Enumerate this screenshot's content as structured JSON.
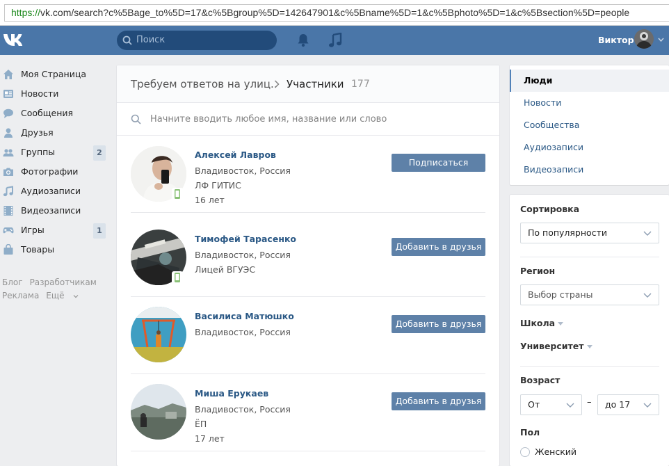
{
  "browser": {
    "url_scheme": "https://",
    "url_rest": "vk.com/search?c%5Bage_to%5D=17&c%5Bgroup%5D=142647901&c%5Bname%5D=1&c%5Bphoto%5D=1&c%5Bsection%5D=people"
  },
  "header": {
    "search_placeholder": "Поиск",
    "user_name": "Виктор",
    "icons": [
      "vk-logo",
      "search-icon",
      "bell-icon",
      "music-icon",
      "avatar",
      "chevron-down-icon"
    ]
  },
  "sidebar": {
    "items": [
      {
        "label": "Моя Страница",
        "icon": "home-icon",
        "count": ""
      },
      {
        "label": "Новости",
        "icon": "news-icon",
        "count": ""
      },
      {
        "label": "Сообщения",
        "icon": "message-icon",
        "count": ""
      },
      {
        "label": "Друзья",
        "icon": "user-icon",
        "count": ""
      },
      {
        "label": "Группы",
        "icon": "users-icon",
        "count": "2"
      },
      {
        "label": "Фотографии",
        "icon": "camera-icon",
        "count": ""
      },
      {
        "label": "Аудиозаписи",
        "icon": "music-icon",
        "count": ""
      },
      {
        "label": "Видеозаписи",
        "icon": "film-icon",
        "count": ""
      },
      {
        "label": "Игры",
        "icon": "gamepad-icon",
        "count": "1"
      },
      {
        "label": "Товары",
        "icon": "bag-icon",
        "count": ""
      }
    ],
    "footer_links": [
      "Блог",
      "Разработчикам",
      "Реклама",
      "Ещё"
    ]
  },
  "main": {
    "group_name": "Требуем ответов на улиц..",
    "section_title": "Участники",
    "member_count": "177",
    "search_placeholder": "Начните вводить любое имя, название или слово",
    "people": [
      {
        "name": "Алексей Лавров",
        "lines": [
          "Владивосток, Россия",
          "ЛФ ГИТИС",
          "16 лет"
        ],
        "button": "Подписаться",
        "mobile": true
      },
      {
        "name": "Тимофей Тарасенко",
        "lines": [
          "Владивосток, Россия",
          "Лицей ВГУЭС"
        ],
        "button": "Добавить в друзья",
        "mobile": true
      },
      {
        "name": "Василиса Матюшко",
        "lines": [
          "Владивосток, Россия"
        ],
        "button": "Добавить в друзья",
        "mobile": false
      },
      {
        "name": "Миша Ерукаев",
        "lines": [
          "Владивосток, Россия",
          "ЁП",
          "17 лет"
        ],
        "button": "Добавить в друзья",
        "mobile": false
      }
    ]
  },
  "right": {
    "tabs": [
      "Люди",
      "Новости",
      "Сообщества",
      "Аудиозаписи",
      "Видеозаписи"
    ],
    "active_tab": "Люди",
    "filters": {
      "sort_label": "Сортировка",
      "sort_value": "По популярности",
      "region_label": "Регион",
      "region_placeholder": "Выбор страны",
      "school_label": "Школа",
      "university_label": "Университет",
      "age_label": "Возраст",
      "age_from": "От",
      "age_dash": "–",
      "age_to": "до 17",
      "sex_label": "Пол",
      "sex_female": "Женский"
    }
  },
  "colors": {
    "header": "#4a76a8",
    "link": "#2a5885",
    "button": "#5e81a8",
    "background": "#edeef0"
  }
}
